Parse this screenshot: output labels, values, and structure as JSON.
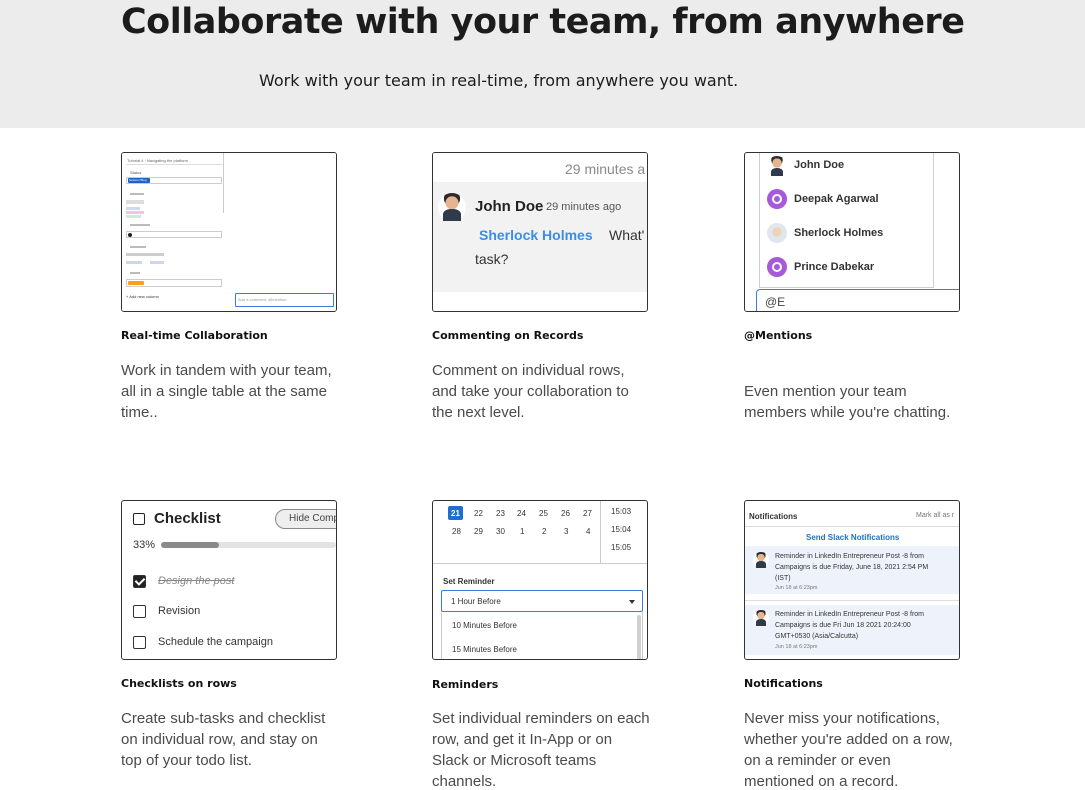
{
  "hero": {
    "title": "Collaborate with your team, from anywhere",
    "subtitle": "Work with your team in real-time, from anywhere you want."
  },
  "features": [
    {
      "title": "Real-time Collaboration",
      "description": "Work in tandem with your team, all in a single table at the same time..",
      "thumb": {
        "header": "Tutorial 4 : Navigating the platform",
        "status_label": "Status",
        "status_value": "Session Blog",
        "add_column": "+ Add new column",
        "comment_placeholder": "Add a comment, @mention"
      }
    },
    {
      "title": "Commenting on Records",
      "description": "Comment on individual rows, and take your collaboration to the next level.",
      "thumb": {
        "top_time": "29 minutes a",
        "author": "John Doe",
        "time": "29 minutes ago",
        "mention": "Sherlock Holmes",
        "message_rest": "What'",
        "message_line2": "task?"
      }
    },
    {
      "title": "@Mentions",
      "description": "Even mention your team members while you're chatting.",
      "thumb": {
        "people": [
          "John Doe",
          "Deepak Agarwal",
          "Sherlock Holmes",
          "Prince Dabekar"
        ],
        "input_value": "@E"
      }
    },
    {
      "title": "Checklists on rows",
      "description": "Create sub-tasks and checklist on individual row, and stay on top of your todo list.",
      "thumb": {
        "heading": "Checklist",
        "hide_button": "Hide Comp",
        "progress": "33%",
        "progress_value": 0.33,
        "items": [
          {
            "label": "Design the post",
            "done": true
          },
          {
            "label": "Revision",
            "done": false
          },
          {
            "label": "Schedule the campaign",
            "done": false
          }
        ]
      }
    },
    {
      "title": "Reminders",
      "description": "Set individual reminders on each row, and get it In-App or on Slack or Microsoft teams channels.",
      "thumb": {
        "week1": [
          "21",
          "22",
          "23",
          "24",
          "25",
          "26",
          "27"
        ],
        "week2": [
          "28",
          "29",
          "30",
          "1",
          "2",
          "3",
          "4"
        ],
        "times": [
          "15:03",
          "15:04",
          "15:05"
        ],
        "set_label": "Set Reminder",
        "selected": "1 Hour Before",
        "options": [
          "10 Minutes Before",
          "15 Minutes Before"
        ]
      }
    },
    {
      "title": "Notifications",
      "description": "Never miss your notifications, whether you're added on a row, on a reminder or even mentioned on a record.",
      "thumb": {
        "heading": "Notifications",
        "mark_all": "Mark all as r",
        "slack_link": "Send Slack Notifications",
        "notes": [
          {
            "line1": "Reminder in LinkedIn Entrepreneur Post -8 from",
            "line2": "Campaigns is due Friday, June 18, 2021 2:54 PM",
            "line3": "(IST)",
            "time": "Jun 18 at 6:23pm"
          },
          {
            "line1": "Reminder in LinkedIn Entrepreneur Post -8 from",
            "line2": "Campaigns is due Fri Jun 18 2021 20:24:00",
            "line3": "GMT+0530 (Asia/Calcutta)",
            "time": "Jun 18 at 6:23pm"
          }
        ]
      }
    }
  ]
}
